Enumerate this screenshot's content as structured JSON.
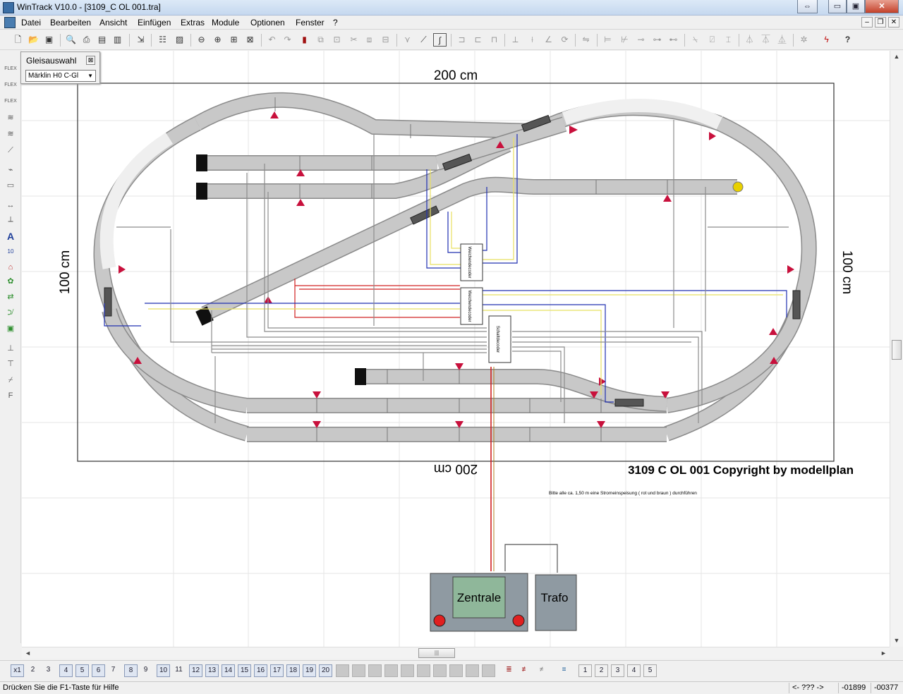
{
  "window": {
    "title": "WinTrack  V10.0 - [3109_C OL 001.tra]",
    "controls": {
      "restore": "⇔",
      "minimize": "▭",
      "maximize": "▣",
      "close": "✕"
    }
  },
  "menu": {
    "items": [
      "Datei",
      "Bearbeiten",
      "Ansicht",
      "Einfügen",
      "Extras",
      "Module",
      "Optionen",
      "Fenster",
      "?"
    ],
    "mdi_controls": {
      "minimize": "–",
      "restore": "❐",
      "close": "✕"
    }
  },
  "toolbar": {
    "icons": [
      "new-file-icon",
      "open-folder-icon",
      "save-icon",
      "print-preview-icon",
      "print-icon",
      "page-setup-icon",
      "print-setup-icon",
      "export-icon",
      "parts-list-icon",
      "image-icon",
      "zoom-out-icon",
      "zoom-in-icon",
      "zoom-window-icon",
      "zoom-all-icon",
      "undo-icon",
      "redo-icon",
      "delete-icon",
      "copy-icon",
      "paste-icon",
      "cut-icon",
      "clipboard-icon",
      "paste-special-icon",
      "switch-icon",
      "signal-icon",
      "free-curve-icon",
      "group-icon",
      "ungroup-icon",
      "lock-icon",
      "measure-icon",
      "height-icon",
      "angle-icon",
      "rotate-icon",
      "mirror-icon",
      "align-icon",
      "join-icon",
      "split-icon",
      "bridge-icon",
      "tunnel-icon",
      "ramp-icon",
      "slope-icon",
      "platform-icon",
      "catenary-icon",
      "power-icon",
      "help-icon"
    ]
  },
  "lefttools": {
    "labels": [
      "FLEX",
      "FLEX",
      "FLEX",
      "≋",
      "≋",
      "⟋",
      "⌁",
      "▭",
      "↔",
      "⟂",
      "A",
      "10",
      "⌂",
      "✿",
      "⇄",
      "⟉",
      "▣",
      "⊥",
      "⊤",
      "⌿",
      "F"
    ]
  },
  "panel": {
    "title": "Gleisauswahl",
    "close": "⊠",
    "select_value": "Märklin H0 C-Gl",
    "select_arrow": "▼"
  },
  "drawing": {
    "dim_top": "200 cm",
    "dim_bottom": "200 cm",
    "dim_left": "100 cm",
    "dim_right": "100 cm",
    "copyright": "3109 C OL 001 Copyright by modellplan",
    "note": "Bitte alle ca. 1,50 m eine Stromeinspeisung ( rot und braun ) durchführen",
    "decoder1": "Weichendecoder",
    "decoder2": "Weichendecoder",
    "decoder3": "Schaltdecoder",
    "central_label": "Zentrale",
    "trafo_label": "Trafo",
    "colors": {
      "track": "#c8c8c8",
      "track_edge": "#8a8a8a",
      "signal": "#c8103c",
      "wire_blue": "#2030b0",
      "wire_red": "#d02020",
      "wire_yellow": "#e8e060",
      "wire_grey": "#8c8c8c",
      "bumper": "#101010",
      "central": "#8f9aa2",
      "central_screen": "#8fb79a",
      "indicator": "#e8d000"
    }
  },
  "scroll": {
    "up": "▲",
    "down": "▼",
    "left": "◄",
    "right": "►",
    "grip": "|||"
  },
  "layerbar": {
    "buttons": [
      "x1",
      "2",
      "3",
      "4",
      "5",
      "6",
      "7",
      "8",
      "9",
      "10",
      "11",
      "12",
      "13",
      "14",
      "15",
      "16",
      "17",
      "18",
      "19",
      "20"
    ],
    "small_buttons": [
      "1",
      "2",
      "3",
      "4",
      "5"
    ]
  },
  "status": {
    "help": "Drücken Sie die  F1-Taste für Hilfe",
    "mode": "<- ??? ->",
    "x": "-01899",
    "y": "-00377"
  }
}
